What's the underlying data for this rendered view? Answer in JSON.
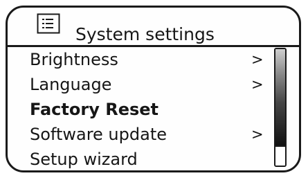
{
  "header": {
    "title": "System settings",
    "icon": "list-icon"
  },
  "menu": {
    "items": [
      {
        "label": "Brightness",
        "has_submenu": true,
        "arrow": ">"
      },
      {
        "label": "Language",
        "has_submenu": true,
        "arrow": ">"
      },
      {
        "label": "Factory Reset",
        "has_submenu": false,
        "selected": true
      },
      {
        "label": "Software update",
        "has_submenu": true,
        "arrow": ">"
      },
      {
        "label": "Setup wizard",
        "has_submenu": false
      }
    ]
  },
  "scrollbar": {
    "position_fraction": 0.84
  }
}
